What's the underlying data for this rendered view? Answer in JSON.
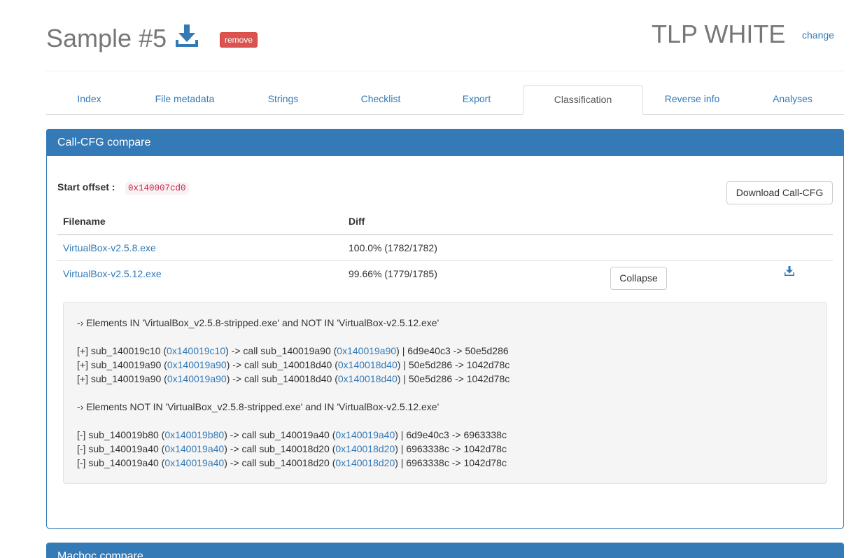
{
  "header": {
    "title": "Sample #5",
    "remove_label": "remove",
    "tlp_label": "TLP WHITE",
    "change_label": "change"
  },
  "tabs": [
    {
      "label": "Index"
    },
    {
      "label": "File metadata"
    },
    {
      "label": "Strings"
    },
    {
      "label": "Checklist"
    },
    {
      "label": "Export"
    },
    {
      "label": "Classification",
      "active": true
    },
    {
      "label": "Reverse info"
    },
    {
      "label": "Analyses"
    }
  ],
  "callcfg": {
    "heading": "Call-CFG compare",
    "start_offset_label": "Start offset :",
    "start_offset_value": "0x140007cd0",
    "download_label": "Download Call-CFG",
    "columns": [
      "Filename",
      "Diff"
    ],
    "rows": [
      {
        "filename": "VirtualBox-v2.5.8.exe",
        "diff": "100.0% (1782/1782)"
      },
      {
        "filename": "VirtualBox-v2.5.12.exe",
        "diff": "99.66% (1779/1785)",
        "collapse_label": "Collapse"
      }
    ],
    "details": {
      "in_heading": "-› Elements IN 'VirtualBox_v2.5.8-stripped.exe' and NOT IN 'VirtualBox-v2.5.12.exe'",
      "in_items": [
        {
          "prefix": "[+] sub_140019c10 (",
          "addr1": "0x140019c10",
          "mid": ") -> call sub_140019a90 (",
          "addr2": "0x140019a90",
          "suffix": ") | 6d9e40c3 -> 50e5d286"
        },
        {
          "prefix": "[+] sub_140019a90 (",
          "addr1": "0x140019a90",
          "mid": ") -> call sub_140018d40 (",
          "addr2": "0x140018d40",
          "suffix": ") | 50e5d286 -> 1042d78c"
        },
        {
          "prefix": "[+] sub_140019a90 (",
          "addr1": "0x140019a90",
          "mid": ") -> call sub_140018d40 (",
          "addr2": "0x140018d40",
          "suffix": ") | 50e5d286 -> 1042d78c"
        }
      ],
      "notin_heading": "-› Elements NOT IN 'VirtualBox_v2.5.8-stripped.exe' and IN 'VirtualBox-v2.5.12.exe'",
      "notin_items": [
        {
          "prefix": "[-] sub_140019b80 (",
          "addr1": "0x140019b80",
          "mid": ") -> call sub_140019a40 (",
          "addr2": "0x140019a40",
          "suffix": ") | 6d9e40c3 -> 6963338c"
        },
        {
          "prefix": "[-] sub_140019a40 (",
          "addr1": "0x140019a40",
          "mid": ") -> call sub_140018d20 (",
          "addr2": "0x140018d20",
          "suffix": ") | 6963338c -> 1042d78c"
        },
        {
          "prefix": "[-] sub_140019a40 (",
          "addr1": "0x140019a40",
          "mid": ") -> call sub_140018d20 (",
          "addr2": "0x140018d20",
          "suffix": ") | 6963338c -> 1042d78c"
        }
      ]
    }
  },
  "machoc": {
    "heading": "Machoc compare"
  },
  "colors": {
    "primary": "#337ab7",
    "danger": "#d9534f",
    "code": "#c7254e"
  }
}
